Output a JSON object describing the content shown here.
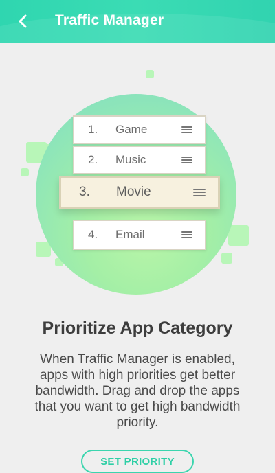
{
  "header": {
    "title": "Traffic Manager",
    "back_icon": "chevron-left-icon"
  },
  "illustration": {
    "items": [
      {
        "num": "1.",
        "name": "Game"
      },
      {
        "num": "2.",
        "name": "Music"
      },
      {
        "num": "3.",
        "name": "Movie"
      },
      {
        "num": "4.",
        "name": "Email"
      }
    ],
    "drag_handle_icon": "drag-handle-icon"
  },
  "content": {
    "heading": "Prioritize App Category",
    "description": "When Traffic Manager is enabled, apps with high priorities get better bandwidth. Drag and drop the apps that you want to get high bandwidth priority.",
    "button_label": "SET PRIORITY"
  },
  "colors": {
    "accent": "#3bd5ae",
    "header": "#31d3b0"
  }
}
